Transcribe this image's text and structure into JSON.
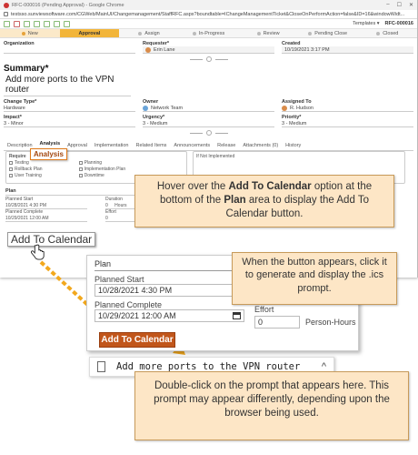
{
  "browser": {
    "title": "RFC-000016 (Pending Approval) - Google Chrome",
    "url": "testsso.sunviewsoftware.com/CGWeb/MainUI/Changemanagement/StaffRFC.aspx?boundtable=IChangeManagementTicket&CloseOnPerformAction=false&ID=16&windowWidt...",
    "templates_label": "Templates ▾",
    "rfc_id": "RFC-000016"
  },
  "steps": [
    "New",
    "Approval",
    "Assign",
    "In-Progress",
    "Review",
    "Pending Close",
    "Closed"
  ],
  "form": {
    "organization_label": "Organization",
    "requester_label": "Requester*",
    "requester_value": "Erin Lane",
    "created_label": "Created",
    "created_value": "10/19/2021 3:17 PM",
    "summary_label": "Summary*",
    "summary_value": "Add more ports to the VPN router",
    "change_type_label": "Change Type*",
    "change_type_value": "Hardware",
    "owner_label": "Owner",
    "owner_value": "Network Team",
    "assigned_label": "Assigned To",
    "assigned_value": "R. Hudson",
    "impact_label": "Impact*",
    "impact_value": "3 - Minor",
    "urgency_label": "Urgency*",
    "urgency_value": "3 - Medium",
    "priority_label": "Priority*",
    "priority_value": "3 - Medium"
  },
  "tabs": [
    "Description",
    "Analysis",
    "Approval",
    "Implementation",
    "Related Items",
    "Announcements",
    "Release",
    "Attachments (0)",
    "History"
  ],
  "analysis_callout": "Analysis",
  "requirements": {
    "header": "Require",
    "items": [
      "Testing",
      "Rollback Plan",
      "User Training",
      "Planning",
      "Implementation Plan",
      "Downtime"
    ],
    "not_implemented": "If Not Implemented"
  },
  "plan_small": {
    "title": "Plan",
    "start_label": "Planned Start",
    "start_value": "10/28/2021 4:30 PM",
    "complete_label": "Planned Complete",
    "complete_value": "10/29/2021 12:00 AM",
    "duration_label": "Duration",
    "duration_value": "0",
    "duration_unit": "Hours",
    "effort_label": "Effort",
    "effort_value": "0"
  },
  "add_to_calendar_small": "Add To Calendar",
  "callouts": {
    "c1_pre": "Hover over the ",
    "c1_b1": "Add To Calendar",
    "c1_mid": " option at the bottom of the ",
    "c1_b2": "Plan",
    "c1_post": " area to display the Add To Calendar button.",
    "c2": "When the button appears, click it to generate and display the .ics prompt.",
    "c3": "Double-click on the prompt that appears here. This prompt may appear differently, depending upon the browser being used."
  },
  "zoom": {
    "title": "Plan",
    "start_label": "Planned Start",
    "start_value": "10/28/2021 4:30 PM",
    "complete_label": "Planned Complete",
    "complete_value": "10/29/2021 12:00 AM",
    "effort_label": "Effort",
    "effort_value": "0",
    "effort_unit": "Person-Hours",
    "button_label": "Add To Calendar"
  },
  "download": {
    "text": "Add more ports to the VPN router",
    "caret": "^"
  },
  "colors": {
    "accent": "#f2b53a",
    "callout_fill": "#fde6c6",
    "button": "#c1561b",
    "arrow": "#f2a81d"
  }
}
